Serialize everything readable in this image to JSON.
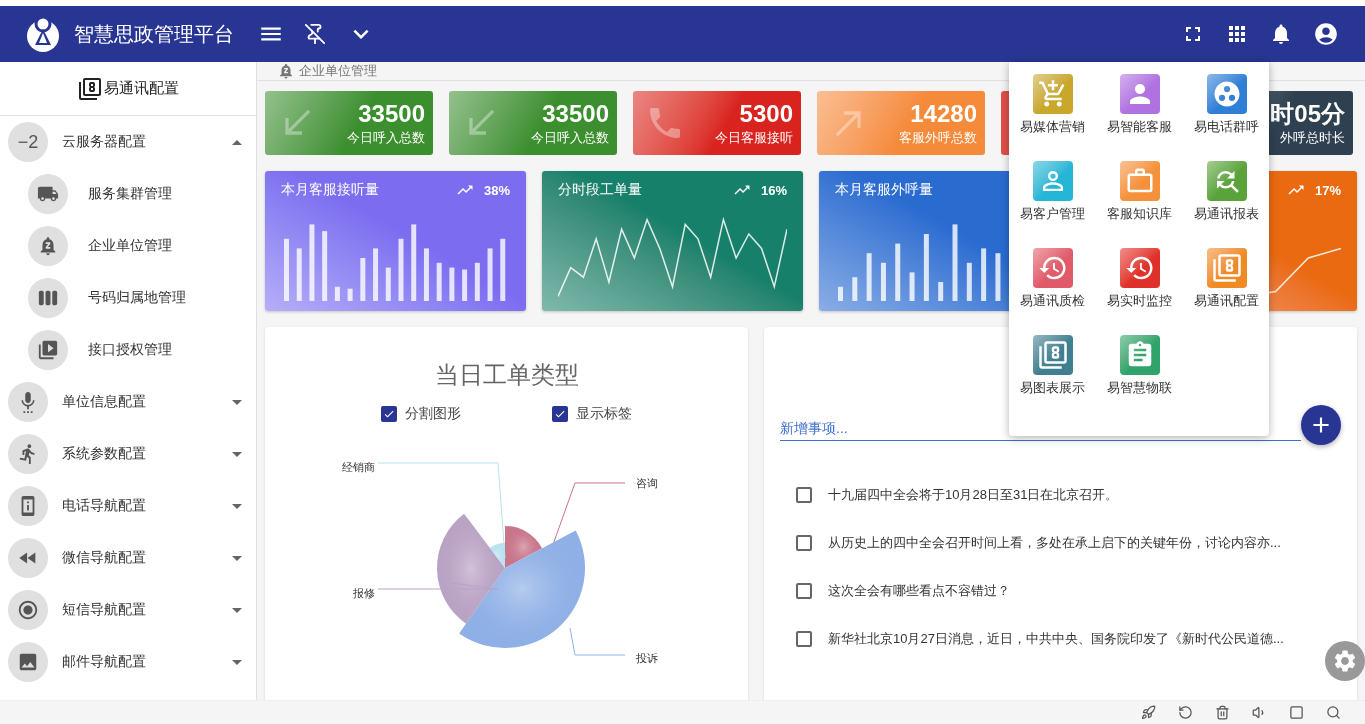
{
  "header": {
    "title": "智慧思政管理平台"
  },
  "sidebar": {
    "title": "易通讯配置",
    "items": [
      {
        "label": "云服务器配置",
        "badge": "−2",
        "expanded": true,
        "children": [
          {
            "label": "服务集群管理"
          },
          {
            "label": "企业单位管理"
          },
          {
            "label": "号码归属地管理"
          },
          {
            "label": "接口授权管理"
          }
        ]
      },
      {
        "label": "单位信息配置",
        "expanded": false
      },
      {
        "label": "系统参数配置",
        "expanded": false
      },
      {
        "label": "电话导航配置",
        "expanded": false
      },
      {
        "label": "微信导航配置",
        "expanded": false
      },
      {
        "label": "短信导航配置",
        "expanded": false
      },
      {
        "label": "邮件导航配置",
        "expanded": false
      }
    ]
  },
  "breadcrumb": "企业单位管理",
  "stats": [
    {
      "value": "33500",
      "label": "今日呼入总数",
      "color": "#3c8f2f"
    },
    {
      "value": "33500",
      "label": "今日呼入总数",
      "color": "#3c8f2f"
    },
    {
      "value": "5300",
      "label": "今日客服接听",
      "color": "#d9231f"
    },
    {
      "value": "14280",
      "label": "客服外呼总数",
      "color": "#f58a3a"
    },
    {
      "color": "#e0504a"
    },
    {
      "value": "时05分",
      "label": "外呼总时长",
      "color": "#2f4150"
    }
  ],
  "trend_cards": [
    {
      "title": "本月客服接听量",
      "change": "38%",
      "kind": "bars",
      "color": "#7b6cf0"
    },
    {
      "title": "分时段工单量",
      "change": "16%",
      "kind": "line",
      "color": "#17806a"
    },
    {
      "title": "本月客服外呼量",
      "kind": "bars",
      "color": "#2a6bd0"
    },
    {
      "change": "17%",
      "kind": "line",
      "color": "#ea6a12"
    }
  ],
  "pie_card": {
    "title": "当日工单类型",
    "options": [
      {
        "label": "分割图形",
        "checked": true
      },
      {
        "label": "显示标签",
        "checked": true
      }
    ],
    "slices": [
      {
        "label": "咨询",
        "color": "#c8758a"
      },
      {
        "label": "投诉",
        "color": "#8fb0e6"
      },
      {
        "label": "报修",
        "color": "#b9a2c4"
      },
      {
        "label": "经销商",
        "color": "#b9e2f2"
      }
    ]
  },
  "todo_card": {
    "placeholder": "新增事项...",
    "items": [
      {
        "text": "十九届四中全会将于10月28日至31日在北京召开。",
        "checked": false
      },
      {
        "text": "从历史上的四中全会召开时间上看，多处在承上启下的关键年份，讨论内容亦...",
        "checked": false
      },
      {
        "text": "这次全会有哪些看点不容错过？",
        "checked": false
      },
      {
        "text": "新华社北京10月27日消息，近日，中共中央、国务院印发了《新时代公民道德...",
        "checked": false
      }
    ]
  },
  "apps_menu": [
    {
      "label": "易媒体营销",
      "color": "#c9a72b"
    },
    {
      "label": "易智能客服",
      "color": "#b072e0"
    },
    {
      "label": "易电话群呼",
      "color": "#2f7fd6"
    },
    {
      "label": "易客户管理",
      "color": "#23b6d6"
    },
    {
      "label": "客服知识库",
      "color": "#f5913a"
    },
    {
      "label": "易通讯报表",
      "color": "#5aa33a"
    },
    {
      "label": "易通讯质检",
      "color": "#e05a6a"
    },
    {
      "label": "易实时监控",
      "color": "#e0302a"
    },
    {
      "label": "易通讯配置",
      "color": "#f08a22"
    },
    {
      "label": "易图表展示",
      "color": "#3f7f8f"
    },
    {
      "label": "易智慧物联",
      "color": "#2fa36a"
    }
  ]
}
